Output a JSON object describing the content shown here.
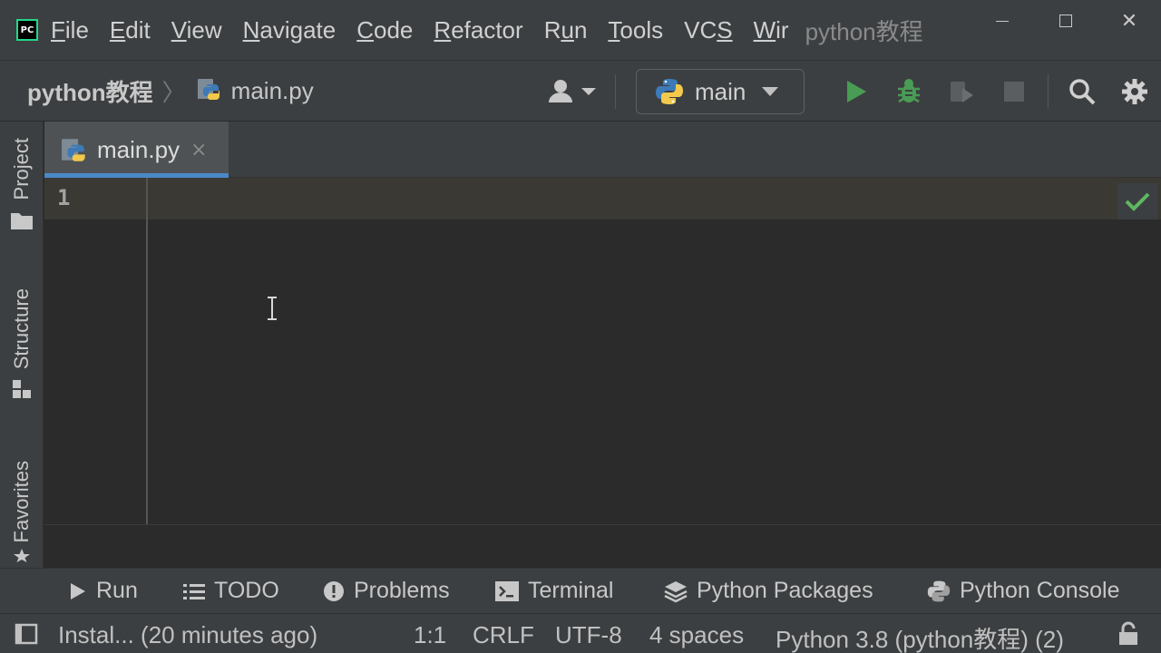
{
  "titlebar": {
    "logo_text": "PC",
    "menu": [
      {
        "mnemonic": "F",
        "rest": "ile"
      },
      {
        "mnemonic": "E",
        "rest": "dit"
      },
      {
        "mnemonic": "V",
        "rest": "iew"
      },
      {
        "mnemonic": "N",
        "rest": "avigate"
      },
      {
        "mnemonic": "C",
        "rest": "ode"
      },
      {
        "mnemonic": "R",
        "rest": "efactor"
      },
      {
        "pre": "R",
        "mnemonic": "u",
        "rest": "n"
      },
      {
        "mnemonic": "T",
        "rest": "ools"
      },
      {
        "pre": "VC",
        "mnemonic": "S",
        "rest": ""
      },
      {
        "mnemonic": "W",
        "rest": "ir"
      }
    ],
    "window_title": "python教程"
  },
  "navbar": {
    "project": "python教程",
    "file": "main.py",
    "run_config": "main"
  },
  "left_tools": {
    "project": "Project",
    "structure": "Structure",
    "favorites": "Favorites"
  },
  "editor": {
    "tab_label": "main.py",
    "tab_close": "×",
    "line_number": "1"
  },
  "tool_windows": {
    "run": "Run",
    "todo": "TODO",
    "problems": "Problems",
    "terminal": "Terminal",
    "python_packages": "Python Packages",
    "python_console": "Python Console"
  },
  "status": {
    "message": "Instal... (20 minutes ago)",
    "position": "1:1",
    "line_separator": "CRLF",
    "encoding": "UTF-8",
    "indent": "4 spaces",
    "interpreter": "Python 3.8 (python教程) (2)"
  },
  "colors": {
    "run_green": "#499c54",
    "tab_accent": "#4a88c7",
    "ok_check": "#5fb760"
  }
}
